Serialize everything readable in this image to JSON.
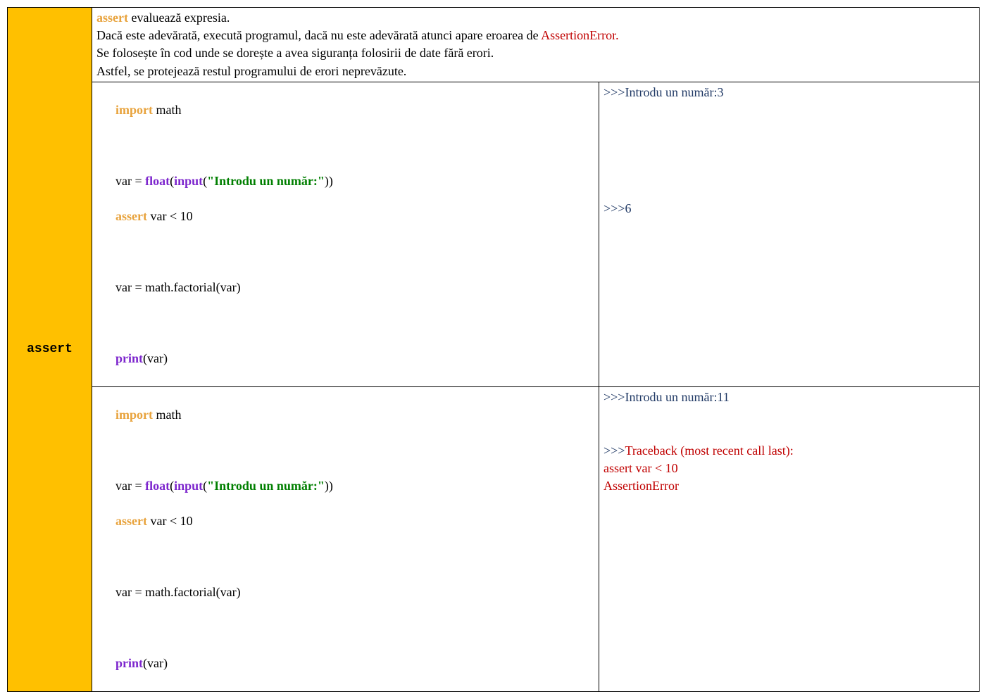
{
  "keyword": "assert",
  "description": {
    "line1_kw": "assert",
    "line1_rest": " evaluează expresia.",
    "line2_a": "Dacă este adevărată, execută programul, dacă nu este adevărată atunci apare eroarea de ",
    "line2_err": "AssertionError.",
    "line3": "Se folosește în cod unde se dorește a avea siguranța folosirii de date fără erori.",
    "line4": "Astfel, se protejează restul programului de erori neprevăzute."
  },
  "example1": {
    "code": {
      "l1_import": "import",
      "l1_math": " math",
      "l3_var_eq": "var = ",
      "l3_float": "float",
      "l3_paren1": "(",
      "l3_input": "input",
      "l3_paren2": "(",
      "l3_str": "\"Introdu un număr:\"",
      "l3_close": "))",
      "l4_assert": "assert",
      "l4_rest": " var < 10",
      "l6": "var = math.factorial(var)",
      "l8_print": "print",
      "l8_rest": "(var)"
    },
    "output": {
      "o1_prompt": ">>>",
      "o1_text": "Introdu un număr:3",
      "o2_prompt": ">>>",
      "o2_text": "6"
    }
  },
  "example2": {
    "code": {
      "l1_import": "import",
      "l1_math": " math",
      "l3_var_eq": "var = ",
      "l3_float": "float",
      "l3_paren1": "(",
      "l3_input": "input",
      "l3_paren2": "(",
      "l3_str": "\"Introdu un număr:\"",
      "l3_close": "))",
      "l4_assert": "assert",
      "l4_rest": " var < 10",
      "l6": "var = math.factorial(var)",
      "l8_print": "print",
      "l8_rest": "(var)"
    },
    "output": {
      "o1_prompt": ">>>",
      "o1_text": "Introdu un număr:11",
      "o2_prompt": ">>>",
      "o2_trace": "Traceback (most recent call last):",
      "o3": "assert var < 10",
      "o4": "AssertionError"
    }
  }
}
